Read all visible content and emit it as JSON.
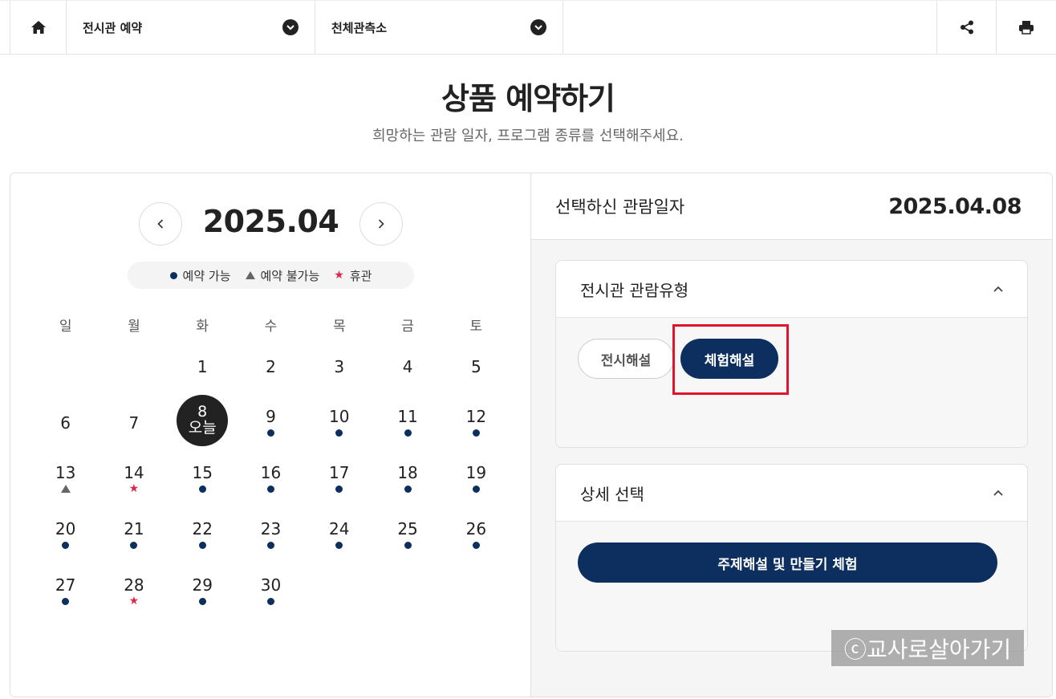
{
  "topbar": {
    "dropdown1_label": "전시관 예약",
    "dropdown2_label": "천체관측소"
  },
  "page": {
    "title": "상품 예약하기",
    "subtitle": "희망하는 관람 일자, 프로그램 종류를 선택해주세요."
  },
  "calendar": {
    "month": "2025.04",
    "legend": {
      "available": "예약 가능",
      "unavailable": "예약 불가능",
      "closed": "휴관"
    },
    "weekdays": [
      "일",
      "월",
      "화",
      "수",
      "목",
      "금",
      "토"
    ],
    "first_weekday_index": 2,
    "today_label": "오늘",
    "days": [
      {
        "day": "1",
        "status": "none"
      },
      {
        "day": "2",
        "status": "none"
      },
      {
        "day": "3",
        "status": "none"
      },
      {
        "day": "4",
        "status": "none"
      },
      {
        "day": "5",
        "status": "none"
      },
      {
        "day": "6",
        "status": "none"
      },
      {
        "day": "7",
        "status": "none"
      },
      {
        "day": "8",
        "status": "today"
      },
      {
        "day": "9",
        "status": "available"
      },
      {
        "day": "10",
        "status": "available"
      },
      {
        "day": "11",
        "status": "available"
      },
      {
        "day": "12",
        "status": "available"
      },
      {
        "day": "13",
        "status": "unavailable"
      },
      {
        "day": "14",
        "status": "closed"
      },
      {
        "day": "15",
        "status": "available"
      },
      {
        "day": "16",
        "status": "available"
      },
      {
        "day": "17",
        "status": "available"
      },
      {
        "day": "18",
        "status": "available"
      },
      {
        "day": "19",
        "status": "available"
      },
      {
        "day": "20",
        "status": "available"
      },
      {
        "day": "21",
        "status": "available"
      },
      {
        "day": "22",
        "status": "available"
      },
      {
        "day": "23",
        "status": "available"
      },
      {
        "day": "24",
        "status": "available"
      },
      {
        "day": "25",
        "status": "available"
      },
      {
        "day": "26",
        "status": "available"
      },
      {
        "day": "27",
        "status": "available"
      },
      {
        "day": "28",
        "status": "closed"
      },
      {
        "day": "29",
        "status": "available"
      },
      {
        "day": "30",
        "status": "available"
      }
    ]
  },
  "selection": {
    "label": "선택하신 관람일자",
    "date": "2025.04.08"
  },
  "viewing_type": {
    "title": "전시관 관람유형",
    "options": [
      "전시해설",
      "체험해설"
    ],
    "selected": "체험해설"
  },
  "detail": {
    "title": "상세 선택",
    "option": "주제해설 및 만들기 체험"
  },
  "watermark": "ⓒ교사로살아가기",
  "colors": {
    "navy": "#0c2f5f",
    "closed_star": "#e0264a",
    "highlight": "#e0152b"
  }
}
